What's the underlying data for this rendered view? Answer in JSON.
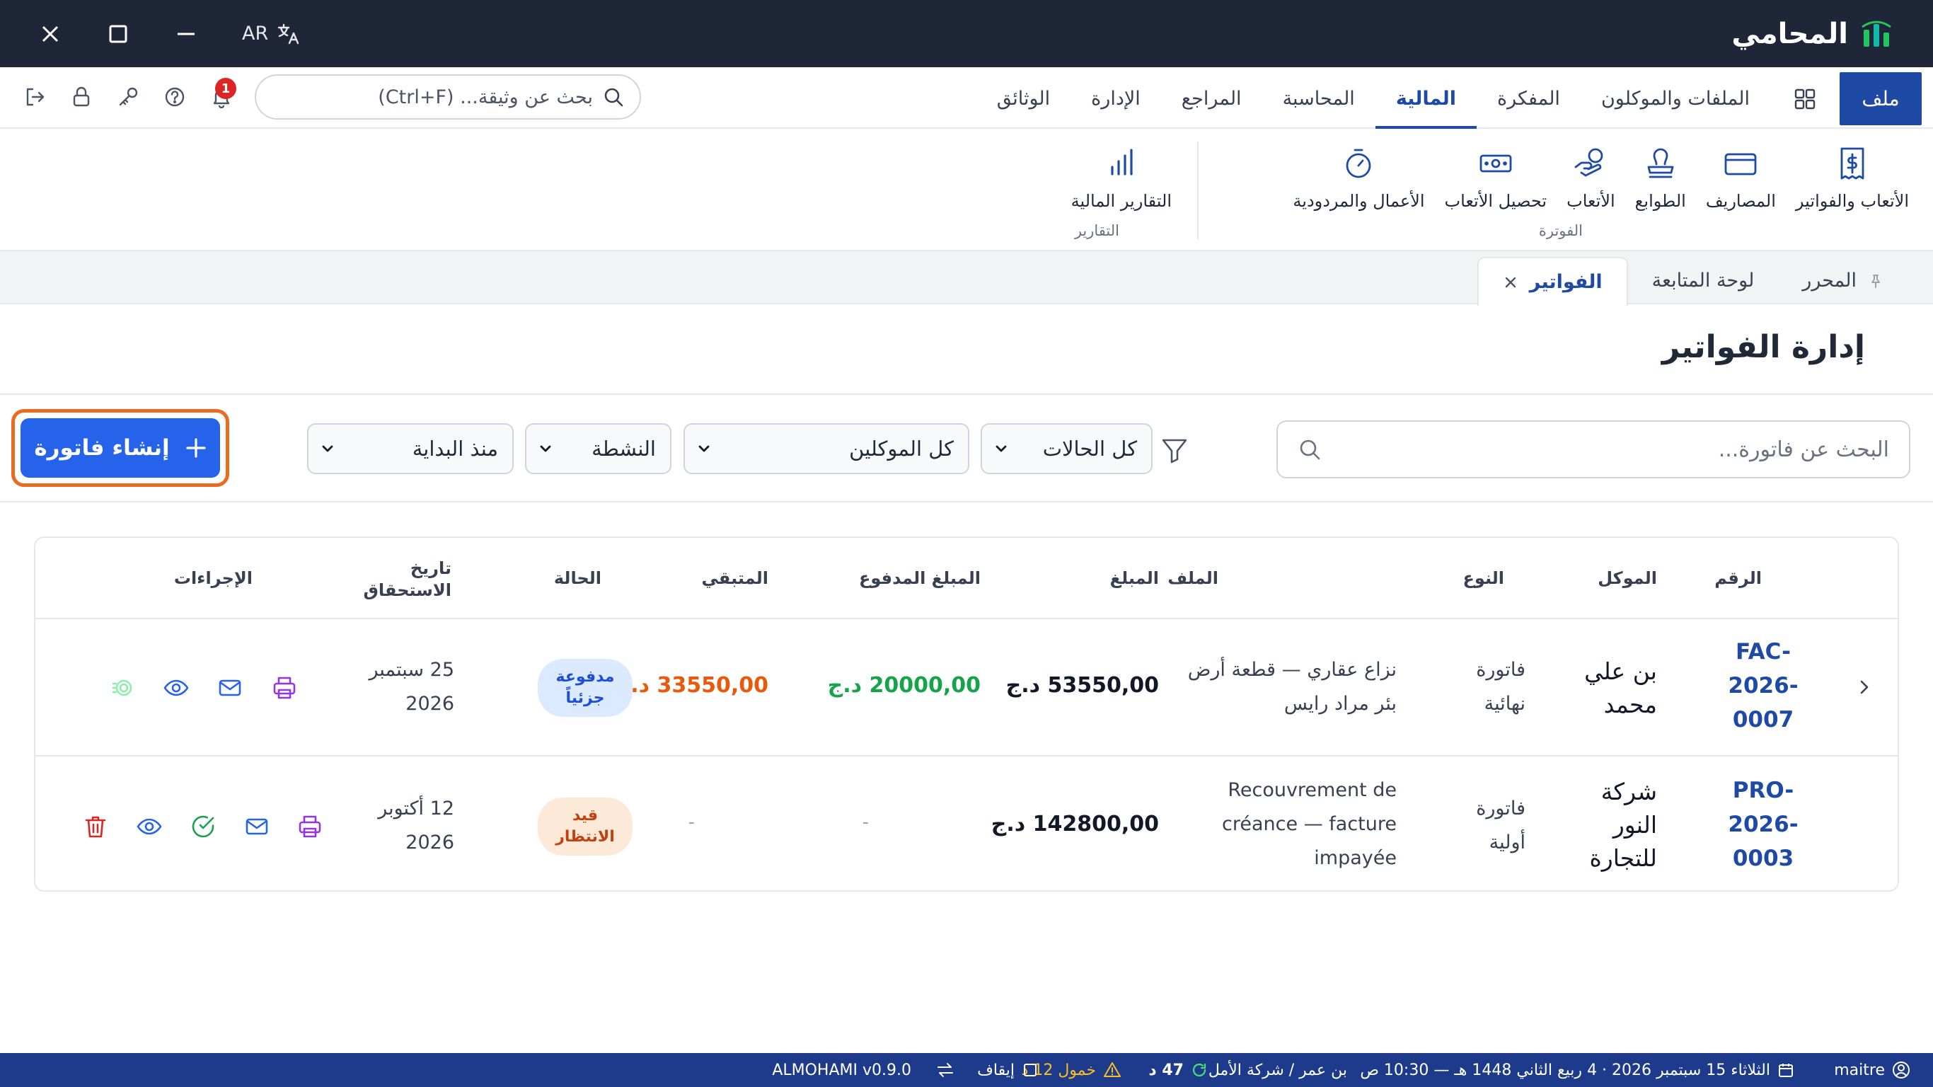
{
  "titlebar": {
    "app_name": "المحامي",
    "lang": "AR"
  },
  "menu": {
    "file_tab": "ملف",
    "tabs": [
      "الملفات والموكلون",
      "المفكرة",
      "المالية",
      "المحاسبة",
      "المراجع",
      "الإدارة",
      "الوثائق"
    ],
    "active_tab": "المالية",
    "search_placeholder": "بحث عن وثيقة... (Ctrl+F)",
    "notification_count": "1"
  },
  "ribbon": {
    "billing_group_label": "الفوترة",
    "reports_group_label": "التقارير",
    "billing_items": [
      {
        "label": "الأتعاب والفواتير",
        "icon": "invoice-icon"
      },
      {
        "label": "المصاريف",
        "icon": "card-icon"
      },
      {
        "label": "الطوابع",
        "icon": "stamp-icon"
      },
      {
        "label": "الأتعاب",
        "icon": "hand-coins-icon"
      },
      {
        "label": "تحصيل الأتعاب",
        "icon": "cash-icon"
      },
      {
        "label": "الأعمال والمردودية",
        "icon": "timer-icon"
      }
    ],
    "report_items": [
      {
        "label": "التقارير المالية",
        "icon": "bar-chart-icon"
      }
    ]
  },
  "page_tabs": [
    {
      "label": "المحرر",
      "pinned": true
    },
    {
      "label": "لوحة المتابعة"
    },
    {
      "label": "الفواتير",
      "active": true,
      "closable": true
    }
  ],
  "page": {
    "title": "إدارة الفواتير",
    "search_placeholder": "البحث عن فاتورة...",
    "filters": {
      "status": "كل الحالات",
      "clients": "كل الموكلين",
      "activity": "النشطة",
      "period": "منذ البداية"
    },
    "create_button": "إنشاء فاتورة"
  },
  "table": {
    "headers": {
      "number": "الرقم",
      "client": "الموكل",
      "type": "النوع",
      "file": "الملف",
      "amount": "المبلغ",
      "paid": "المبلغ المدفوع",
      "remaining": "المتبقي",
      "status": "الحالة",
      "due_line1": "تاريخ",
      "due_line2": "الاستحقاق",
      "actions": "الإجراءات"
    },
    "rows": [
      {
        "num1": "FAC-",
        "num2": "2026-",
        "num3": "0007",
        "client1": "بن علي",
        "client2": "محمد",
        "type1": "فاتورة",
        "type2": "نهائية",
        "file1": "نزاع عقاري — قطعة أرض",
        "file2": "بئر مراد رايس",
        "amount": "53550,00 د.ج",
        "paid": "20000,00 د.ج",
        "remaining": "33550,00 د.ج",
        "status1": "مدفوعة",
        "status2": "جزئياً",
        "due1": "25 سبتمبر",
        "due2": "2026"
      },
      {
        "num1": "PRO-",
        "num2": "2026-",
        "num3": "0003",
        "client1": "شركة",
        "client2": "النور",
        "client3": "للتجارة",
        "type1": "فاتورة",
        "type2": "أولية",
        "file1": "Recouvrement de",
        "file2": "créance — facture",
        "file3": "impayée",
        "amount": "142800,00 د.ج",
        "paid": "-",
        "remaining": "-",
        "status1": "قيد",
        "status2": "الانتظار",
        "due1": "12 أكتوبر",
        "due2": "2026"
      }
    ]
  },
  "statusbar": {
    "user": "maitre",
    "date": "الثلاثاء 15 سبتمبر 2026 · 4 ربيع الثاني 1448 هـ — 10:30 ص",
    "timer_value": "47 د",
    "context": "بن عمر / شركة الأمل",
    "idle": "خمول 12 د",
    "pause": "إيقاف",
    "version": "ALMOHAMI v0.9.0"
  },
  "colors": {
    "titlebar": "#1e2638",
    "primary": "#1e4aa6",
    "create_button": "#2563eb",
    "create_ring": "#ea6a1f",
    "paid_green": "#16a34a",
    "remaining_orange": "#ea580c",
    "statusbar": "#1e3a8a"
  }
}
